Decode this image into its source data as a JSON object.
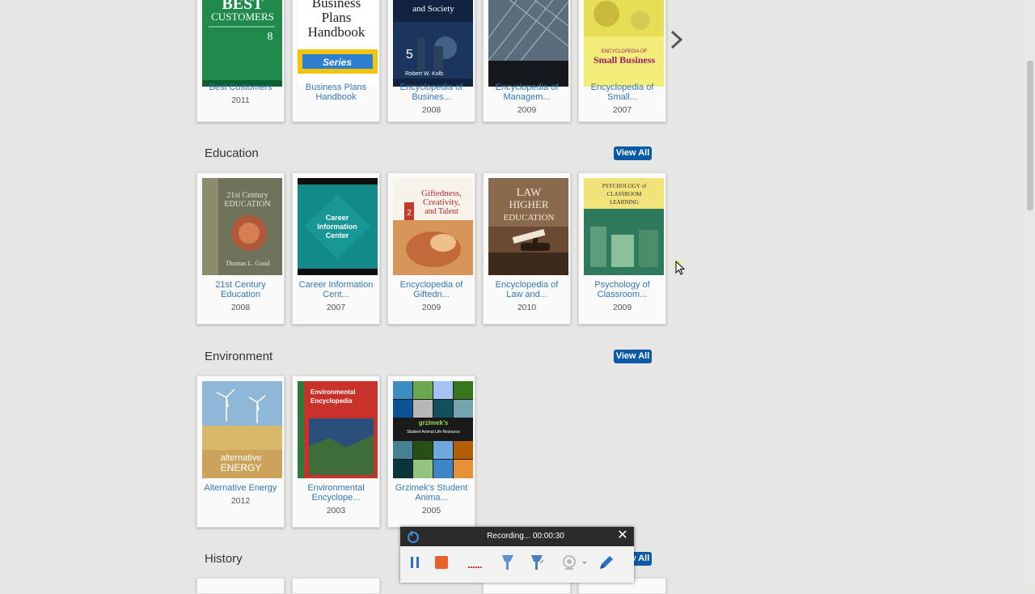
{
  "rows": [
    {
      "section": "",
      "books": [
        {
          "title_line1": "Best Customers",
          "title_line2": "",
          "year": "2011"
        },
        {
          "title_line1": "Business Plans",
          "title_line2": "Handbook",
          "year": ""
        },
        {
          "title_line1": "Encyclopedia of",
          "title_line2": "Busines...",
          "year": "2008"
        },
        {
          "title_line1": "Encyclopedia of",
          "title_line2": "Managem...",
          "year": "2009"
        },
        {
          "title_line1": "Encyclopedia of",
          "title_line2": "Small...",
          "year": "2007"
        }
      ]
    },
    {
      "section": "Education",
      "view_all": "View All",
      "books": [
        {
          "title_line1": "21st Century",
          "title_line2": "Education",
          "year": "2008"
        },
        {
          "title_line1": "Career Information",
          "title_line2": "Cent...",
          "year": "2007"
        },
        {
          "title_line1": "Encyclopedia of",
          "title_line2": "Giftedn...",
          "year": "2009"
        },
        {
          "title_line1": "Encyclopedia of",
          "title_line2": "Law and...",
          "year": "2010"
        },
        {
          "title_line1": "Psychology of",
          "title_line2": "Classroom...",
          "year": "2009"
        }
      ]
    },
    {
      "section": "Environment",
      "view_all": "View All",
      "books": [
        {
          "title_line1": "Alternative Energy",
          "title_line2": "",
          "year": "2012"
        },
        {
          "title_line1": "Environmental",
          "title_line2": "Encyclope...",
          "year": "2003"
        },
        {
          "title_line1": "Grzimek's Student",
          "title_line2": "Anima...",
          "year": "2005"
        }
      ]
    },
    {
      "section": "History",
      "view_all": "View All"
    }
  ],
  "covers": {
    "best_customers": {
      "line1": "BEST",
      "line2": "CUSTOMERS",
      "num": "8",
      "color": "#1f8a4c"
    },
    "business_plans": {
      "line1": "Business",
      "line2": "Plans",
      "line3": "Handbook",
      "band": "Series",
      "band_color": "#f2c40f"
    },
    "enc_business": {
      "line1": "and Society",
      "vol": "5",
      "editor": "Robert W. Kolb"
    },
    "enc_small": {
      "line1": "ENCYCLOPEDIA OF",
      "line2": "Small Business"
    },
    "century": {
      "line1": "21st Century",
      "line2": "EDUCATION",
      "author": "Thomas L. Good"
    },
    "career": {
      "line1": "Career",
      "line2": "Information",
      "line3": "Center"
    },
    "gifted": {
      "line1": "Giftedness,",
      "line2": "Creativity,",
      "line3": "and Talent",
      "vol": "2"
    },
    "law": {
      "line1": "LAW",
      "line2": "HIGHER",
      "line3": "EDUCATION"
    },
    "psych": {
      "line1": "PSYCHOLOGY of",
      "line2": "CLASSROOM",
      "line3": "LEARNING"
    },
    "alt_energy": {
      "line1": "alternative",
      "line2": "ENERGY"
    },
    "env": {
      "line1": "Environmental",
      "line2": "Encyclopedia"
    },
    "grzimek": {
      "line1": "grzimek's",
      "line2": "Student Animal Life Resource"
    }
  },
  "recorder": {
    "status": "Recording... 00:00:30",
    "close": "✕",
    "pause_color": "#2a72c2",
    "stop_color": "#e8602c"
  }
}
